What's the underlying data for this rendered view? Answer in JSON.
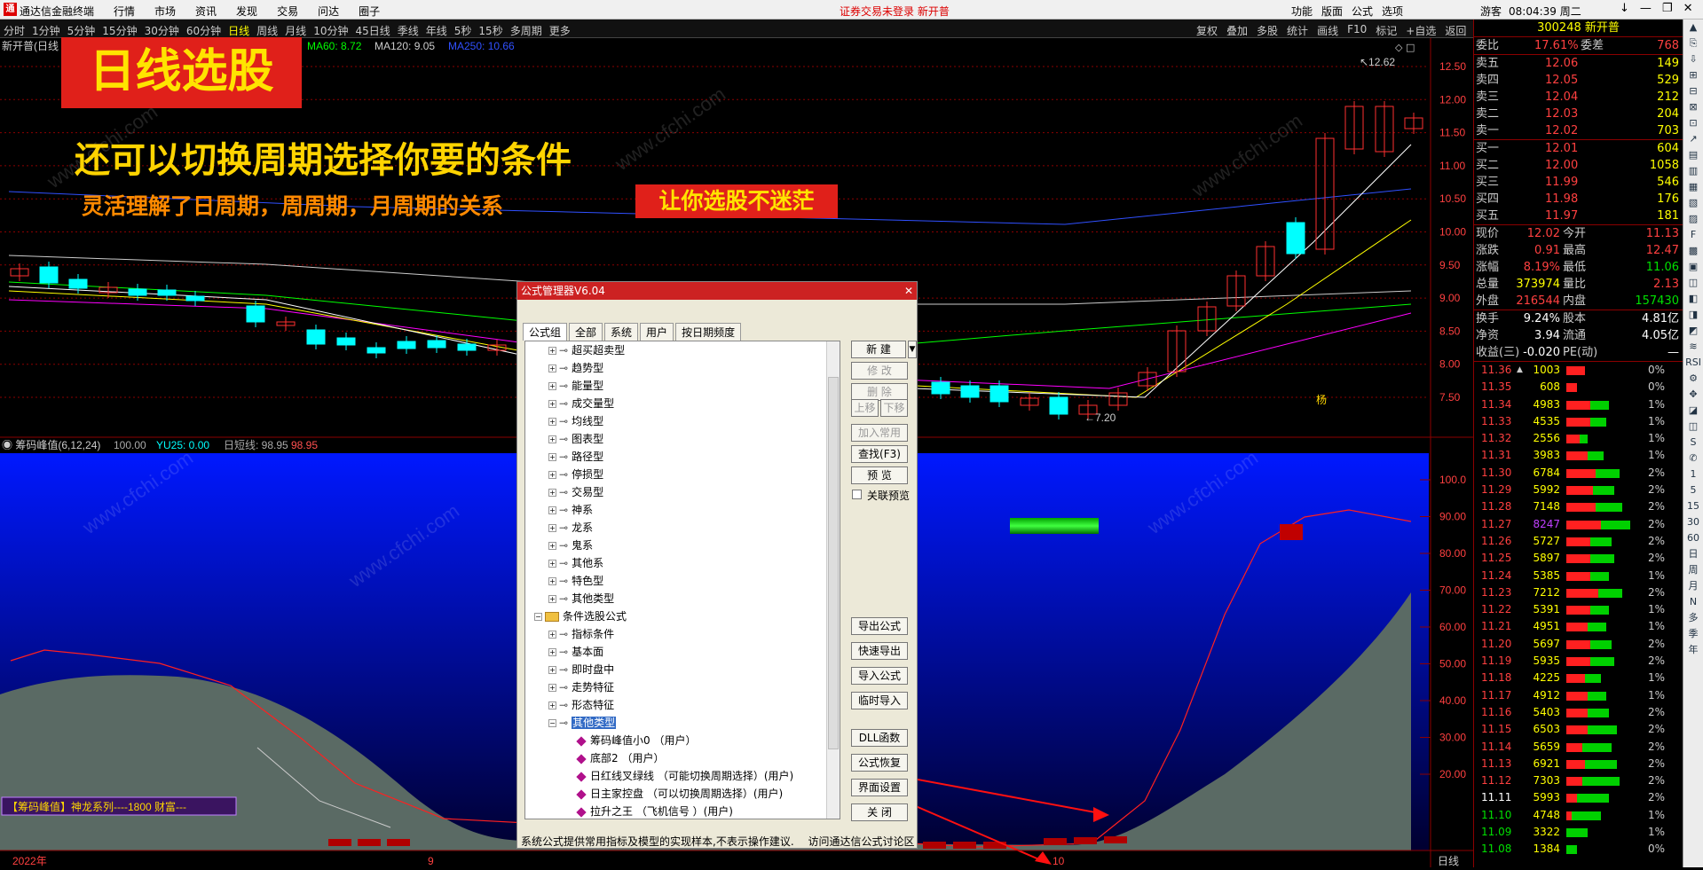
{
  "titlebar": {
    "app_name": "通达信金融终端",
    "menus": [
      "行情",
      "市场",
      "资讯",
      "发现",
      "交易",
      "问达",
      "圈子"
    ],
    "warning": "证券交易未登录 新开普",
    "right_menus": [
      "功能",
      "版面",
      "公式",
      "选项"
    ],
    "guest": "游客",
    "clock": "08:04:39 周二",
    "window_buttons": [
      "↓",
      "—",
      "❐",
      "✕"
    ]
  },
  "periodbar": {
    "items": [
      "分时",
      "1分钟",
      "5分钟",
      "15分钟",
      "30分钟",
      "60分钟",
      "日线",
      "周线",
      "月线",
      "10分钟",
      "45日线",
      "季线",
      "年线",
      "5秒",
      "15秒",
      "多周期",
      "更多"
    ],
    "active": "日线",
    "right_items": [
      "复权",
      "叠加",
      "多股",
      "统计",
      "画线",
      "F10",
      "标记",
      "+自选",
      "返回"
    ]
  },
  "chart": {
    "stock_label": "新开普(日线",
    "ma_labels": [
      {
        "text": "MA60: 8.72",
        "color": "#00ff00"
      },
      {
        "text": "MA120: 9.05",
        "color": "#cccccc"
      },
      {
        "text": "MA250: 10.66",
        "color": "#3050ff"
      }
    ],
    "high_label": "12.62",
    "low_label": "7.20",
    "price_ticks": [
      "12.50",
      "12.00",
      "11.50",
      "11.00",
      "10.50",
      "10.00",
      "9.50",
      "9.00",
      "8.50",
      "8.00",
      "7.50"
    ],
    "indicator_name": "筹码峰值(6,12,24)",
    "indicator_values": [
      {
        "text": "100.00",
        "color": "#aaaaaa"
      },
      {
        "text": "YU25: 0.00",
        "color": "#00ffff"
      },
      {
        "text": "日短线: 98.95",
        "color": "#aaaaaa"
      },
      {
        "text": "98.95",
        "color": "#ff5050"
      }
    ],
    "indicator_ticks": [
      "100.0",
      "90.00",
      "80.00",
      "70.00",
      "60.00",
      "50.00",
      "40.00",
      "30.00",
      "20.00"
    ],
    "x_labels": [
      "2022年",
      "9",
      "10"
    ],
    "period_label": "日线",
    "badge": "【筹码峰值】神龙系列----1800 财富---",
    "mark": "杨"
  },
  "overlay": {
    "title": "日线选股",
    "line1": "还可以切换周期选择你要的条件",
    "line2": "灵活理解了日周期，周周期，月周期的关系",
    "line3": "让你选股不迷茫",
    "watermark": "www.cfchi.com"
  },
  "dialog": {
    "title": "公式管理器V6.04",
    "tabs": [
      "公式组",
      "全部",
      "系统",
      "用户",
      "按日期频度"
    ],
    "tree": [
      {
        "label": "超买超卖型",
        "level": 1
      },
      {
        "label": "趋势型",
        "level": 1
      },
      {
        "label": "能量型",
        "level": 1
      },
      {
        "label": "成交量型",
        "level": 1
      },
      {
        "label": "均线型",
        "level": 1
      },
      {
        "label": "图表型",
        "level": 1
      },
      {
        "label": "路径型",
        "level": 1
      },
      {
        "label": "停损型",
        "level": 1
      },
      {
        "label": "交易型",
        "level": 1
      },
      {
        "label": "神系",
        "level": 1
      },
      {
        "label": "龙系",
        "level": 1
      },
      {
        "label": "鬼系",
        "level": 1
      },
      {
        "label": "其他系",
        "level": 1
      },
      {
        "label": "特色型",
        "level": 1
      },
      {
        "label": "其他类型",
        "level": 1
      },
      {
        "label": "条件选股公式",
        "level": 0
      },
      {
        "label": "指标条件",
        "level": 1
      },
      {
        "label": "基本面",
        "level": 1
      },
      {
        "label": "即时盘中",
        "level": 1
      },
      {
        "label": "走势特征",
        "level": 1
      },
      {
        "label": "形态特征",
        "level": 1
      },
      {
        "label": "其他类型",
        "level": 1,
        "selected": true
      },
      {
        "label": "筹码峰值小0 （用户）",
        "level": 2
      },
      {
        "label": "底部2 （用户）",
        "level": 2
      },
      {
        "label": "日红线叉绿线 （可能切换周期选择）(用户)",
        "level": 2
      },
      {
        "label": "日主家控盘 （可以切换周期选择）(用户)",
        "level": 2
      },
      {
        "label": "拉升之王 （飞机信号 ）(用户)",
        "level": 2
      }
    ],
    "buttons_top": [
      {
        "label": "新 建",
        "disabled": false
      },
      {
        "label": "修 改",
        "disabled": true
      },
      {
        "label": "删 除",
        "disabled": true
      }
    ],
    "btn_up": "上移",
    "btn_down": "下移",
    "btn_add_common": "加入常用",
    "btn_find": "查找(F3)",
    "btn_preview": "预 览",
    "checkbox_label": "关联预览",
    "buttons_bottom": [
      "导出公式",
      "快速导出",
      "导入公式",
      "临时导入",
      "DLL函数",
      "公式恢复",
      "界面设置",
      "关 闭"
    ],
    "footer_left": "系统公式提供常用指标及模型的实现样本,不表示操作建议.",
    "footer_right": "访问通达信公式讨论区"
  },
  "quote": {
    "code_name": "300248 新开普",
    "weibi": {
      "label": "委比",
      "value": "17.61%",
      "label2": "委差",
      "value2": "768"
    },
    "sells": [
      {
        "label": "卖五",
        "price": "12.06",
        "vol": "149"
      },
      {
        "label": "卖四",
        "price": "12.05",
        "vol": "529"
      },
      {
        "label": "卖三",
        "price": "12.04",
        "vol": "212"
      },
      {
        "label": "卖二",
        "price": "12.03",
        "vol": "204"
      },
      {
        "label": "卖一",
        "price": "12.02",
        "vol": "703"
      }
    ],
    "buys": [
      {
        "label": "买一",
        "price": "12.01",
        "vol": "604"
      },
      {
        "label": "买二",
        "price": "12.00",
        "vol": "1058"
      },
      {
        "label": "买三",
        "price": "11.99",
        "vol": "546"
      },
      {
        "label": "买四",
        "price": "11.98",
        "vol": "176"
      },
      {
        "label": "买五",
        "price": "11.97",
        "vol": "181"
      }
    ],
    "stats": [
      {
        "l1": "现价",
        "v1": "12.02",
        "l2": "今开",
        "v2": "11.13",
        "c1": "#ff4040",
        "c2": "#ff4040"
      },
      {
        "l1": "涨跌",
        "v1": "0.91",
        "l2": "最高",
        "v2": "12.47",
        "c1": "#ff4040",
        "c2": "#ff4040"
      },
      {
        "l1": "涨幅",
        "v1": "8.19%",
        "l2": "最低",
        "v2": "11.06",
        "c1": "#ff4040",
        "c2": "#00e000"
      },
      {
        "l1": "总量",
        "v1": "373974",
        "l2": "量比",
        "v2": "2.13",
        "c1": "#ffff00",
        "c2": "#ff4040"
      },
      {
        "l1": "外盘",
        "v1": "216544",
        "l2": "内盘",
        "v2": "157430",
        "c1": "#ff4040",
        "c2": "#00e000"
      }
    ],
    "stats2": [
      {
        "l1": "换手",
        "v1": "9.24%",
        "l2": "股本",
        "v2": "4.81亿"
      },
      {
        "l1": "净资",
        "v1": "3.94",
        "l2": "流通",
        "v2": "4.05亿"
      },
      {
        "l1": "收益(三)",
        "v1": "-0.020",
        "l2": "PE(动)",
        "v2": "—"
      }
    ],
    "ticks": [
      {
        "p": "11.36",
        "v": "1003",
        "pct": "0%",
        "r": 0.35,
        "g": 0.0,
        "hl": true
      },
      {
        "p": "11.35",
        "v": "608",
        "pct": "0%",
        "r": 0.2,
        "g": 0.0
      },
      {
        "p": "11.34",
        "v": "4983",
        "pct": "1%",
        "r": 0.45,
        "g": 0.35
      },
      {
        "p": "11.33",
        "v": "4535",
        "pct": "1%",
        "r": 0.45,
        "g": 0.3
      },
      {
        "p": "11.32",
        "v": "2556",
        "pct": "1%",
        "r": 0.25,
        "g": 0.15
      },
      {
        "p": "11.31",
        "v": "3983",
        "pct": "1%",
        "r": 0.4,
        "g": 0.3
      },
      {
        "p": "11.30",
        "v": "6784",
        "pct": "2%",
        "r": 0.55,
        "g": 0.45
      },
      {
        "p": "11.29",
        "v": "5992",
        "pct": "2%",
        "r": 0.5,
        "g": 0.4
      },
      {
        "p": "11.28",
        "v": "7148",
        "pct": "2%",
        "r": 0.55,
        "g": 0.5
      },
      {
        "p": "11.27",
        "v": "8247",
        "pct": "2%",
        "r": 0.65,
        "g": 0.55,
        "purple": true
      },
      {
        "p": "11.26",
        "v": "5727",
        "pct": "2%",
        "r": 0.45,
        "g": 0.4
      },
      {
        "p": "11.25",
        "v": "5897",
        "pct": "2%",
        "r": 0.45,
        "g": 0.45
      },
      {
        "p": "11.24",
        "v": "5385",
        "pct": "1%",
        "r": 0.45,
        "g": 0.35
      },
      {
        "p": "11.23",
        "v": "7212",
        "pct": "2%",
        "r": 0.6,
        "g": 0.45
      },
      {
        "p": "11.22",
        "v": "5391",
        "pct": "1%",
        "r": 0.45,
        "g": 0.35
      },
      {
        "p": "11.21",
        "v": "4951",
        "pct": "1%",
        "r": 0.4,
        "g": 0.35
      },
      {
        "p": "11.20",
        "v": "5697",
        "pct": "2%",
        "r": 0.45,
        "g": 0.4
      },
      {
        "p": "11.19",
        "v": "5935",
        "pct": "2%",
        "r": 0.45,
        "g": 0.45
      },
      {
        "p": "11.18",
        "v": "4225",
        "pct": "1%",
        "r": 0.35,
        "g": 0.3
      },
      {
        "p": "11.17",
        "v": "4912",
        "pct": "1%",
        "r": 0.4,
        "g": 0.35
      },
      {
        "p": "11.16",
        "v": "5403",
        "pct": "2%",
        "r": 0.4,
        "g": 0.4
      },
      {
        "p": "11.15",
        "v": "6503",
        "pct": "2%",
        "r": 0.4,
        "g": 0.55
      },
      {
        "p": "11.14",
        "v": "5659",
        "pct": "2%",
        "r": 0.3,
        "g": 0.55
      },
      {
        "p": "11.13",
        "v": "6921",
        "pct": "2%",
        "r": 0.35,
        "g": 0.6
      },
      {
        "p": "11.12",
        "v": "7303",
        "pct": "2%",
        "r": 0.3,
        "g": 0.7
      },
      {
        "p": "11.11",
        "v": "5993",
        "pct": "2%",
        "r": 0.2,
        "g": 0.6,
        "white": true
      },
      {
        "p": "11.10",
        "v": "4748",
        "pct": "1%",
        "r": 0.1,
        "g": 0.55,
        "green": true
      },
      {
        "p": "11.09",
        "v": "3322",
        "pct": "1%",
        "r": 0.0,
        "g": 0.4,
        "green": true
      },
      {
        "p": "11.08",
        "v": "1384",
        "pct": "0%",
        "r": 0.0,
        "g": 0.2,
        "green": true
      }
    ]
  },
  "vtools": [
    "▲",
    "⎘",
    "⇩",
    "⊞",
    "⊟",
    "⊠",
    "⊡",
    "↗",
    "▤",
    "▥",
    "▦",
    "▧",
    "▨",
    "F",
    "▩",
    "▣",
    "◫",
    "◧",
    "◨",
    "◩",
    "≋",
    "RSI",
    "⚙",
    "✥",
    "◪",
    "◫",
    "S",
    "✆",
    "1",
    "5",
    "15",
    "30",
    "60",
    "日",
    "周",
    "月",
    "N",
    "多",
    "季",
    "年"
  ],
  "colors": {
    "up": "#ff3030",
    "down": "#00ffff",
    "ma5": "#ffffff",
    "ma10": "#ffff00",
    "ma20": "#ff00ff",
    "ma60": "#00ff00",
    "ma120": "#cccccc",
    "ma250": "#3050ff",
    "grid": "#8b0000"
  }
}
